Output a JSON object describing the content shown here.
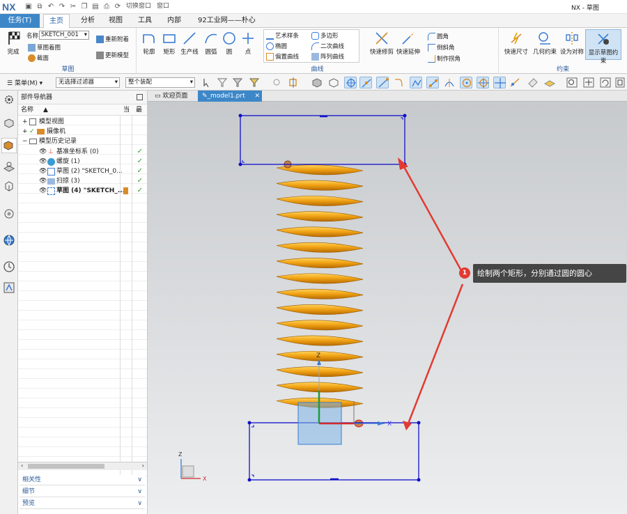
{
  "app": {
    "logo": "NX",
    "window_title": "NX - 草图"
  },
  "quick_access": {
    "switch_window": "切换窗口",
    "window": "窗口"
  },
  "tabs": [
    {
      "label": "任务(T)"
    },
    {
      "label": "主页"
    },
    {
      "label": "分析"
    },
    {
      "label": "视图"
    },
    {
      "label": "工具"
    },
    {
      "label": "内部"
    },
    {
      "label": "92工业网——朴心"
    }
  ],
  "ribbon": {
    "sketch_group": {
      "label": "草图",
      "finish": "完成",
      "name_label": "名称",
      "name_value": "SKETCH_001",
      "orient_view": "草图着图",
      "orient_plane": "截面",
      "reattach": "重新附着",
      "update_model": "更新模型"
    },
    "curve_group": {
      "label": "曲线",
      "profile": "轮廓",
      "rectangle": "矩形",
      "line": "生产线",
      "arc": "圆弧",
      "circle": "圆",
      "point": "点",
      "studio_spline": "艺术样条",
      "ellipse": "椭圆",
      "offset_curve": "偏置曲线",
      "polygon": "多边形",
      "conic": "二次曲线",
      "pattern_curve": "阵列曲线",
      "quick_trim": "快速修剪",
      "quick_extend": "快速延伸",
      "fillet": "圆角",
      "chamfer": "倒斜角",
      "make_corner": "制作拐角"
    },
    "constraint_group": {
      "label": "约束",
      "rapid_dimension": "快速尺寸",
      "geometric_constraints": "几何约束",
      "make_symmetric": "设为对称",
      "show_constraints": "显示草图约束"
    }
  },
  "toolbar2": {
    "menu": "菜单(M)",
    "filter": "无选择过滤器",
    "assembly": "整个装配"
  },
  "navigator": {
    "title": "部件导航器",
    "col_name": "名称",
    "col_current": "当",
    "col_latest": "最",
    "items": [
      {
        "label": "模型视图"
      },
      {
        "label": "摄像机"
      },
      {
        "label": "模型历史记录"
      },
      {
        "label": "基准坐标系 (0)"
      },
      {
        "label": "螺旋 (1)"
      },
      {
        "label": "草图 (2) \"SKETCH_0..."
      },
      {
        "label": "扫掠 (3)"
      },
      {
        "label": "草图 (4) \"SKETCH_..."
      }
    ],
    "accordion": [
      "相关性",
      "细节",
      "预览"
    ]
  },
  "doc_tabs": [
    {
      "label": "欢迎页面"
    },
    {
      "label": "_model1.prt"
    }
  ],
  "callout": {
    "number": "1",
    "text": "绘制两个矩形，分别通过圆的圆心"
  },
  "axes": {
    "x": "X",
    "y": "Y",
    "z": "Z"
  },
  "colors": {
    "spring": "#f2a516",
    "sketch_blue": "#1010c8",
    "arrow_red": "#e23a32",
    "accent": "#3d87c8"
  }
}
